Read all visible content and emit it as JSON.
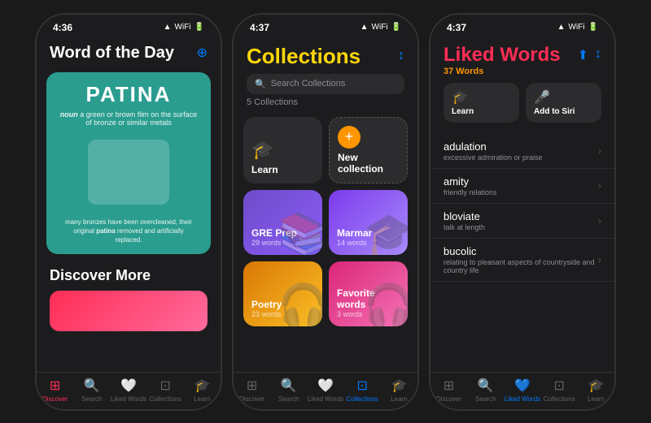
{
  "phone1": {
    "status_time": "4:36",
    "title": "Word of the Day",
    "word": "PATINA",
    "pos": "noun",
    "definition": "a green or brown film on the surface of bronze or similar metals",
    "sentence": "many bronzes have been overcleaned, their original patina removed and artificially replaced.",
    "discover_more": "Discover More",
    "tabs": [
      "Discover",
      "Search",
      "Liked Words",
      "Collections",
      "Learn"
    ]
  },
  "phone2": {
    "status_time": "4:37",
    "title": "Collections",
    "search_placeholder": "Search Collections",
    "count_label": "5 Collections",
    "collections": [
      {
        "id": "learn",
        "name": "Learn",
        "icon": "🎓",
        "bg_icon": "🎓",
        "type": "learn"
      },
      {
        "id": "new",
        "name": "New collection",
        "icon": "+",
        "type": "new"
      },
      {
        "id": "gre",
        "name": "GRE Prep",
        "count": "29 words",
        "bg_icon": "📚",
        "type": "gre"
      },
      {
        "id": "marmar",
        "name": "Marmar",
        "count": "14 words",
        "bg_icon": "🎓",
        "type": "marmar"
      },
      {
        "id": "poetry",
        "name": "Poetry",
        "count": "23 words",
        "bg_icon": "🎧",
        "type": "poetry"
      },
      {
        "id": "fav",
        "name": "Favorite words",
        "count": "3 words",
        "bg_icon": "🎧",
        "type": "fav"
      }
    ],
    "tabs": [
      "Discover",
      "Search",
      "Liked Words",
      "Collections",
      "Learn"
    ]
  },
  "phone3": {
    "status_time": "4:37",
    "title": "Liked Words",
    "word_count": "37 Words",
    "actions": [
      {
        "icon": "🎓",
        "label": "Learn"
      },
      {
        "icon": "🎤",
        "label": "Add to Siri"
      }
    ],
    "words": [
      {
        "word": "adulation",
        "def": "excessive admiration or praise"
      },
      {
        "word": "amity",
        "def": "friendly relations"
      },
      {
        "word": "bloviate",
        "def": "talk at length"
      },
      {
        "word": "bucolic",
        "def": "relating to pleasant aspects of countryside and country life"
      }
    ],
    "tabs": [
      "Discover",
      "Search",
      "Liked Words",
      "Collections",
      "Learn"
    ]
  }
}
